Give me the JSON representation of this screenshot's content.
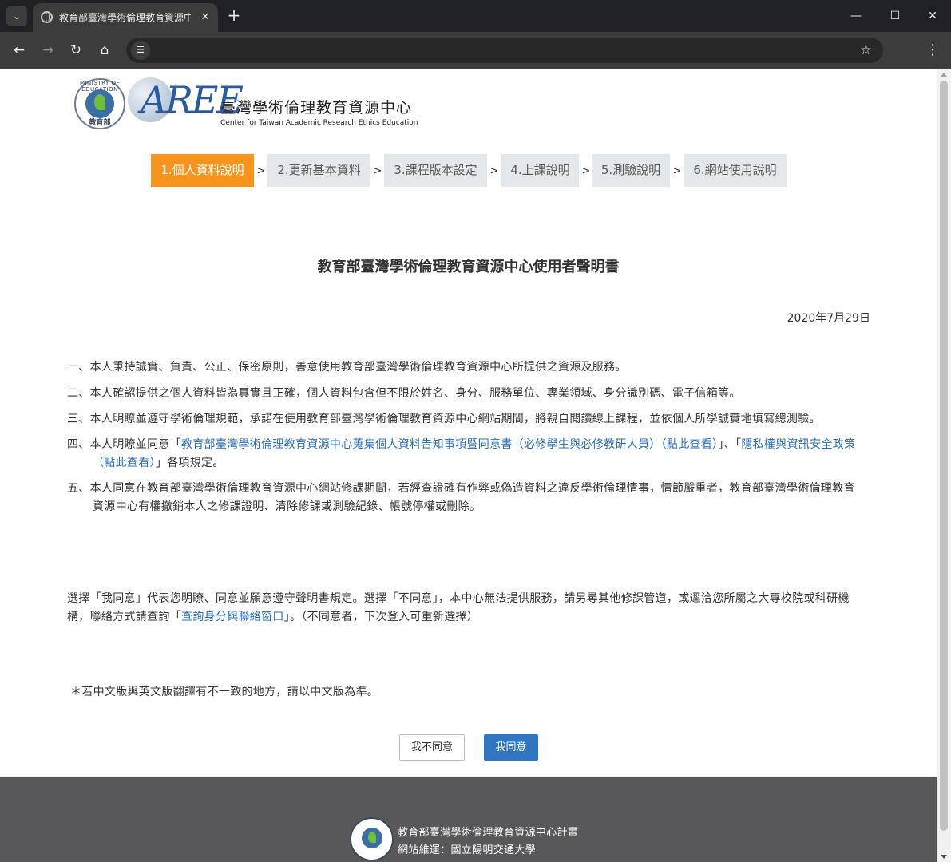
{
  "browser": {
    "tab_title": "教育部臺灣學術倫理教育資源中心",
    "tab_close": "✕",
    "new_tab": "+",
    "url": "",
    "win_minimize": "—",
    "win_maximize": "☐",
    "win_close": "✕"
  },
  "header": {
    "seal_text": "MINISTRY OF EDUCATION",
    "seal_bottom": "教育部",
    "logo_mark": "AREE",
    "title_zh": "臺灣學術倫理教育資源中心",
    "title_en": "Center for Taiwan Academic Research Ethics Education"
  },
  "steps": [
    {
      "label": "1.個人資料說明",
      "active": true
    },
    {
      "label": "2.更新基本資料",
      "active": false
    },
    {
      "label": "3.課程版本設定",
      "active": false
    },
    {
      "label": "4.上課說明",
      "active": false
    },
    {
      "label": "5.測驗說明",
      "active": false
    },
    {
      "label": "6.網站使用說明",
      "active": false
    }
  ],
  "step_separator": ">",
  "document": {
    "title": "教育部臺灣學術倫理教育資源中心使用者聲明書",
    "date": "2020年7月29日",
    "clause1": "一、本人秉持誠實、負責、公正、保密原則，善意使用教育部臺灣學術倫理教育資源中心所提供之資源及服務。",
    "clause2": "二、本人確認提供之個人資料皆為真實且正確，個人資料包含但不限於姓名、身分、服務單位、專業領域、身分識別碼、電子信箱等。",
    "clause3": "三、本人明瞭並遵守學術倫理規範，承諾在使用教育部臺灣學術倫理教育資源中心網站期間，將親自閱讀線上課程，並依個人所學誠實地填寫總測驗。",
    "clause4_prefix": "四、本人明瞭並同意「",
    "clause4_link1": "教育部臺灣學術倫理教育資源中心蒐集個人資料告知事項暨同意書（必修學生與必修教研人員）（點此查看）",
    "clause4_mid": "」、「",
    "clause4_link2": "隱私權與資訊安全政策（點此查看）",
    "clause4_suffix": "」各項規定。",
    "clause5": "五、本人同意在教育部臺灣學術倫理教育資源中心網站修課期間，若經查證確有作弊或偽造資料之違反學術倫理情事，情節嚴重者，教育部臺灣學術倫理教育資源中心有權撤銷本人之修課證明、清除修課或測驗紀錄、帳號停權或刪除。",
    "notice_prefix": "選擇「我同意」代表您明瞭、同意並願意遵守聲明書規定。選擇「不同意」，本中心無法提供服務，請另尋其他修課管道，或逕洽您所屬之大專校院或科研機構，聯絡方式請查詢「",
    "notice_link": "查詢身分與聯絡窗口",
    "notice_suffix": "」。（不同意者，下次登入可重新選擇）",
    "footnote": "＊若中文版與英文版翻譯有不一致的地方，請以中文版為準。"
  },
  "actions": {
    "disagree": "我不同意",
    "agree": "我同意"
  },
  "footer": {
    "line1": "教育部臺灣學術倫理教育資源中心計畫",
    "line2": "網站維運：國立陽明交通大學"
  },
  "colors": {
    "accent_step": "#f7941d",
    "agree_button": "#2f75c0",
    "link": "#2a6db5",
    "footer_bg": "#58585a"
  }
}
